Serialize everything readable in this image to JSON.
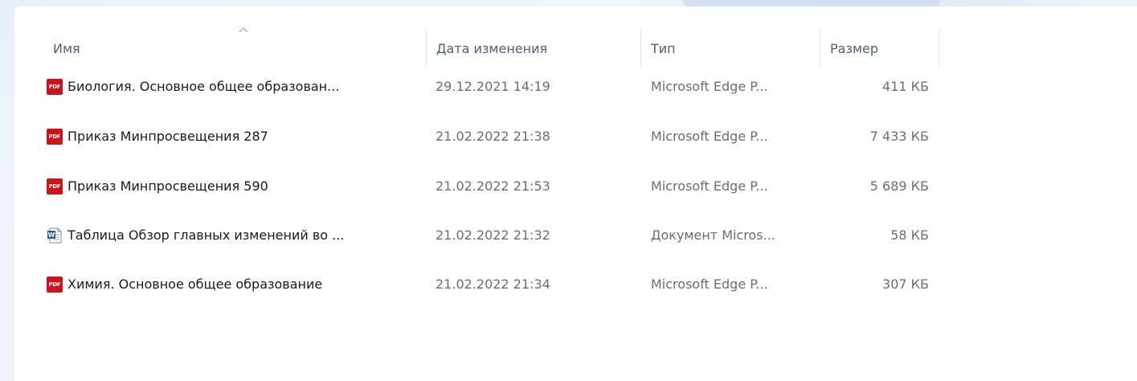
{
  "columns": {
    "name": "Имя",
    "date": "Дата изменения",
    "type": "Тип",
    "size": "Размер"
  },
  "sort": {
    "column": "name",
    "direction": "ascending"
  },
  "icons": {
    "pdf": "pdf-file-icon",
    "word": "word-document-icon",
    "sort": "sort-ascending-icon"
  },
  "colors": {
    "pdf_red": "#c8141b",
    "word_blue": "#2b5797",
    "header_text": "#4c607a",
    "meta_text": "#6d6d6d"
  },
  "files": [
    {
      "icon": "pdf",
      "name": "Биология. Основное общее образован...",
      "date": "29.12.2021 14:19",
      "type": "Microsoft Edge P...",
      "size": "411 КБ"
    },
    {
      "icon": "pdf",
      "name": "Приказ Минпросвещения 287",
      "date": "21.02.2022 21:38",
      "type": "Microsoft Edge P...",
      "size": "7 433 КБ"
    },
    {
      "icon": "pdf",
      "name": "Приказ Минпросвещения 590",
      "date": "21.02.2022 21:53",
      "type": "Microsoft Edge P...",
      "size": "5 689 КБ"
    },
    {
      "icon": "word",
      "name": "Таблица Обзор главных изменений во ...",
      "date": "21.02.2022 21:32",
      "type": "Документ Micros...",
      "size": "58 КБ"
    },
    {
      "icon": "pdf",
      "name": "Химия. Основное общее образование",
      "date": "21.02.2022 21:34",
      "type": "Microsoft Edge P...",
      "size": "307 КБ"
    }
  ]
}
